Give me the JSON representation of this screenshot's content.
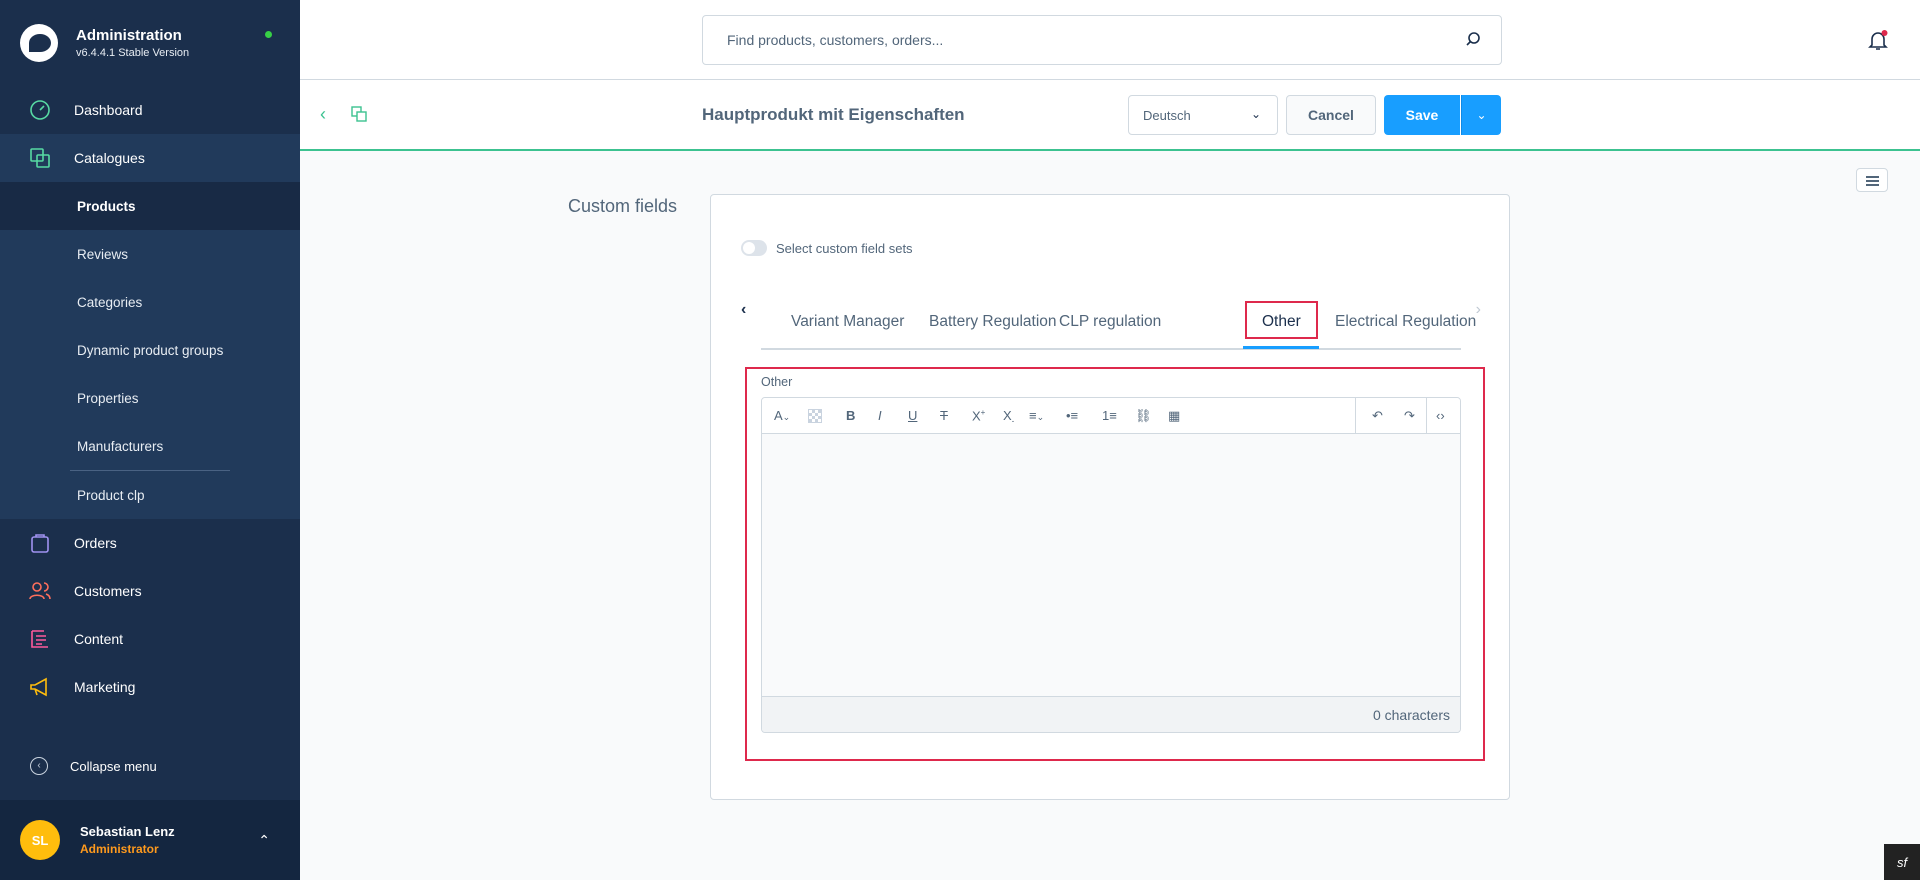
{
  "brand": {
    "title": "Administration",
    "version": "v6.4.4.1 Stable Version"
  },
  "nav": {
    "dashboard": "Dashboard",
    "catalogues": "Catalogues",
    "sub": [
      "Products",
      "Reviews",
      "Categories",
      "Dynamic product groups",
      "Properties",
      "Manufacturers",
      "Product clp"
    ],
    "orders": "Orders",
    "customers": "Customers",
    "content": "Content",
    "marketing": "Marketing",
    "collapse": "Collapse menu"
  },
  "user": {
    "initials": "SL",
    "name": "Sebastian Lenz",
    "role": "Administrator"
  },
  "search": {
    "placeholder": "Find products, customers, orders..."
  },
  "smartbar": {
    "title": "Hauptprodukt mit Eigenschaften",
    "language": "Deutsch",
    "cancel": "Cancel",
    "save": "Save"
  },
  "custom_fields": {
    "section_label": "Custom fields",
    "toggle_label": "Select custom field sets",
    "tabs": [
      "Variant Manager",
      "Battery Regulation",
      "CLP regulation",
      "Other",
      "Electrical Regulation"
    ],
    "active_tab": "Other",
    "editor_label": "Other",
    "char_count": "0 characters"
  },
  "colors": {
    "sidebar": "#1b2f4c",
    "accent": "#189eff",
    "highlight": "#de294c",
    "success": "#3cc290"
  }
}
